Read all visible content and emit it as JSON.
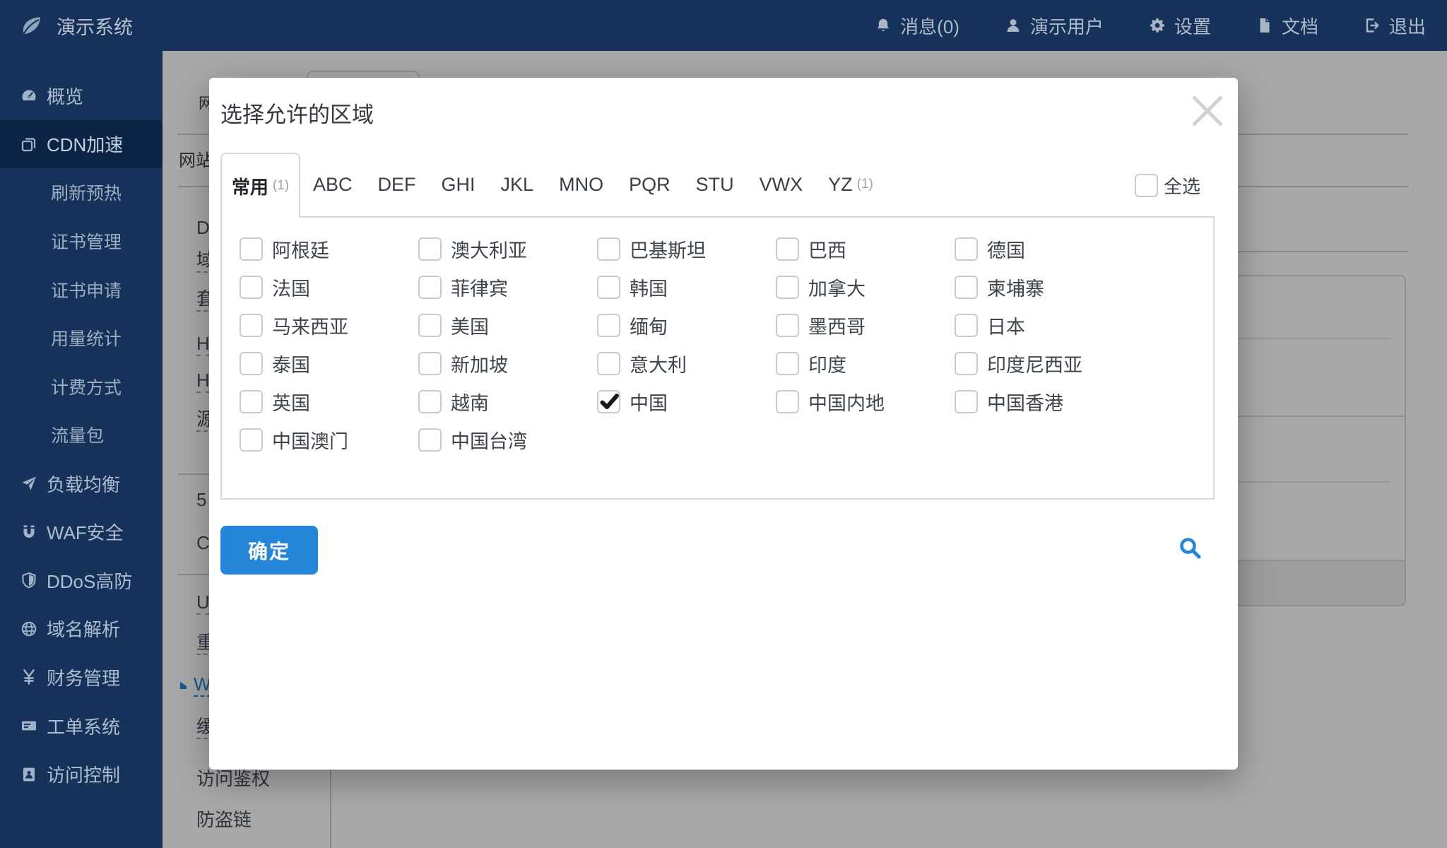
{
  "colors": {
    "brand_navy": "#16325A",
    "brand_navy_active": "#0C2546",
    "accent_blue": "#2386D8",
    "overlay_grey": "#A9A9A9"
  },
  "app": {
    "title": "演示系统",
    "logo_icon": "leaf-icon"
  },
  "topbar": {
    "items": [
      {
        "label": "消息(0)",
        "icon": "bell-icon"
      },
      {
        "label": "演示用户",
        "icon": "user-icon"
      },
      {
        "label": "设置",
        "icon": "gear-icon"
      },
      {
        "label": "文档",
        "icon": "doc-icon"
      },
      {
        "label": "退出",
        "icon": "logout-icon"
      }
    ]
  },
  "sidebar": {
    "items": [
      {
        "label": "概览",
        "icon": "gauge-icon"
      },
      {
        "label": "CDN加速",
        "icon": "cdn-icon",
        "active": true
      },
      {
        "label": "刷新预热",
        "sub": true
      },
      {
        "label": "证书管理",
        "sub": true
      },
      {
        "label": "证书申请",
        "sub": true
      },
      {
        "label": "用量统计",
        "sub": true
      },
      {
        "label": "计费方式",
        "sub": true
      },
      {
        "label": "流量包",
        "sub": true
      },
      {
        "label": "负载均衡",
        "icon": "send-icon"
      },
      {
        "label": "WAF安全",
        "icon": "waf-icon"
      },
      {
        "label": "DDoS高防",
        "icon": "shield-icon"
      },
      {
        "label": "域名解析",
        "icon": "globe-icon"
      },
      {
        "label": "财务管理",
        "icon": "yen-icon"
      },
      {
        "label": "工单系统",
        "icon": "ticket-icon"
      },
      {
        "label": "访问控制",
        "icon": "badge-icon"
      }
    ]
  },
  "background_page": {
    "page_title_fragment": "网",
    "menu_group_label": "网站",
    "menu_items": [
      {
        "label": "D"
      },
      {
        "label": "域",
        "dashed": true
      },
      {
        "label": "套",
        "dashed": true
      },
      {
        "label": "H",
        "dashed": true
      },
      {
        "label": "H",
        "dashed": true
      },
      {
        "label": "源",
        "dashed": true
      },
      {
        "label": "5"
      },
      {
        "label": "C"
      },
      {
        "label": "U",
        "dashed": true
      },
      {
        "label": "重",
        "dashed": true
      },
      {
        "label": "W",
        "dashed": true,
        "active": true
      },
      {
        "label": "缓",
        "dashed": true
      },
      {
        "label": "访问鉴权"
      },
      {
        "label": "防盗链"
      }
    ]
  },
  "modal": {
    "title": "选择允许的区域",
    "close_icon": "close-icon",
    "tabs": [
      {
        "label": "常用",
        "suffix": "(1)",
        "active": true
      },
      {
        "label": "ABC"
      },
      {
        "label": "DEF"
      },
      {
        "label": "GHI"
      },
      {
        "label": "JKL"
      },
      {
        "label": "MNO"
      },
      {
        "label": "PQR"
      },
      {
        "label": "STU"
      },
      {
        "label": "VWX"
      },
      {
        "label": "YZ",
        "suffix": "(1)"
      }
    ],
    "select_all_label": "全选",
    "select_all_checked": false,
    "countries": [
      {
        "label": "阿根廷",
        "checked": false
      },
      {
        "label": "澳大利亚",
        "checked": false
      },
      {
        "label": "巴基斯坦",
        "checked": false
      },
      {
        "label": "巴西",
        "checked": false
      },
      {
        "label": "德国",
        "checked": false
      },
      {
        "label": "法国",
        "checked": false
      },
      {
        "label": "菲律宾",
        "checked": false
      },
      {
        "label": "韩国",
        "checked": false
      },
      {
        "label": "加拿大",
        "checked": false
      },
      {
        "label": "柬埔寨",
        "checked": false
      },
      {
        "label": "马来西亚",
        "checked": false
      },
      {
        "label": "美国",
        "checked": false
      },
      {
        "label": "缅甸",
        "checked": false
      },
      {
        "label": "墨西哥",
        "checked": false
      },
      {
        "label": "日本",
        "checked": false
      },
      {
        "label": "泰国",
        "checked": false
      },
      {
        "label": "新加坡",
        "checked": false
      },
      {
        "label": "意大利",
        "checked": false
      },
      {
        "label": "印度",
        "checked": false
      },
      {
        "label": "印度尼西亚",
        "checked": false
      },
      {
        "label": "英国",
        "checked": false
      },
      {
        "label": "越南",
        "checked": false
      },
      {
        "label": "中国",
        "checked": true
      },
      {
        "label": "中国内地",
        "checked": false
      },
      {
        "label": "中国香港",
        "checked": false
      },
      {
        "label": "中国澳门",
        "checked": false
      },
      {
        "label": "中国台湾",
        "checked": false
      }
    ],
    "confirm_label": "确定",
    "search_icon": "search-icon"
  }
}
